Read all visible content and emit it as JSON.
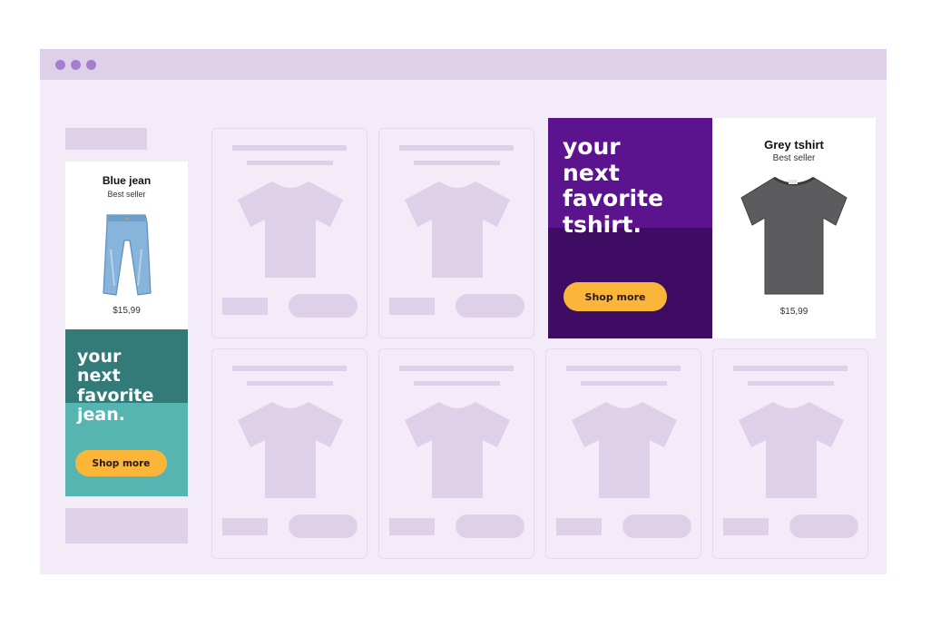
{
  "window": {
    "controls": [
      "close",
      "minimize",
      "maximize"
    ]
  },
  "promo_left": {
    "product_title": "Blue jean",
    "product_subtitle": "Best seller",
    "price": "$15,99",
    "headline": "your\nnext\nfavorite\njean.",
    "cta_label": "Shop more",
    "colors": {
      "band_top": "#327b79",
      "band_bottom": "#56b5b0",
      "cta": "#fbb63a",
      "jean": "#7fb0d8"
    }
  },
  "promo_right": {
    "headline": "your\nnext\nfavorite\ntshirt.",
    "cta_label": "Shop more",
    "product_title": "Grey tshirt",
    "product_subtitle": "Best seller",
    "price": "$15,99",
    "colors": {
      "band_top": "#5c148e",
      "band_bottom": "#3e0d63",
      "cta": "#fbb63a",
      "tshirt": "#5a5a5a"
    }
  },
  "placeholder_cards": {
    "count": 6,
    "icon": "tshirt-icon",
    "color": "#dfd0e9"
  }
}
